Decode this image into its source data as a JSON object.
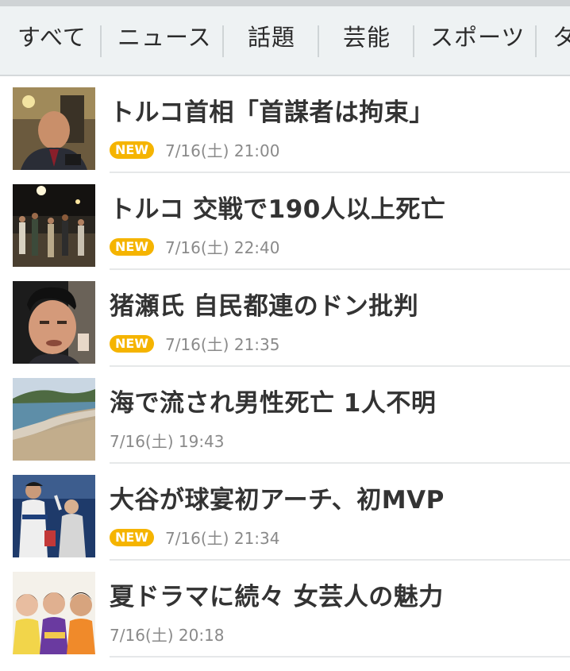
{
  "tabs": [
    {
      "label": "すべて"
    },
    {
      "label": "ニュース"
    },
    {
      "label": "話題"
    },
    {
      "label": "芸能"
    },
    {
      "label": "スポーツ"
    },
    {
      "label": "タ"
    }
  ],
  "articles": [
    {
      "title": "トルコ首相「首謀者は拘束」",
      "badge": "NEW",
      "time": "7/16(土) 21:00",
      "thumbnail": "turkey-prime-minister-photo"
    },
    {
      "title": "トルコ 交戦で190人以上死亡",
      "badge": "NEW",
      "time": "7/16(土) 22:40",
      "thumbnail": "night-street-crowd-photo"
    },
    {
      "title": "猪瀬氏 自民都連のドン批判",
      "badge": "NEW",
      "time": "7/16(土) 21:35",
      "thumbnail": "politician-portrait-photo"
    },
    {
      "title": "海で流され男性死亡 1人不明",
      "badge": "",
      "time": "7/16(土) 19:43",
      "thumbnail": "beach-photo"
    },
    {
      "title": "大谷が球宴初アーチ、初MVP",
      "badge": "NEW",
      "time": "7/16(土) 21:34",
      "thumbnail": "baseball-player-photo"
    },
    {
      "title": "夏ドラマに続々 女芸人の魅力",
      "badge": "",
      "time": "7/16(土) 20:18",
      "thumbnail": "comedians-group-photo"
    }
  ],
  "colors": {
    "badge": "#f5b400",
    "tabbar_bg": "#eef2f3",
    "headline": "#333333",
    "time": "#8a8a8a"
  }
}
